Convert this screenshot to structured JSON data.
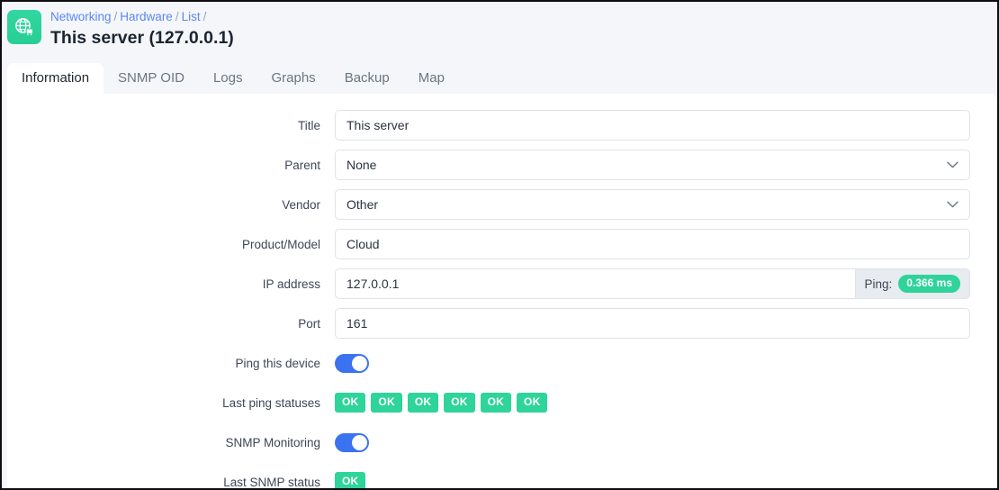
{
  "header": {
    "logo_icon": "globe-network-icon",
    "logo_color": "#2ed49a",
    "breadcrumb": [
      {
        "label": "Networking",
        "sep": "/"
      },
      {
        "label": "Hardware",
        "sep": "/"
      },
      {
        "label": "List",
        "sep": "/"
      }
    ],
    "title": "This server (127.0.0.1)"
  },
  "tabs": [
    {
      "label": "Information",
      "active": true
    },
    {
      "label": "SNMP OID",
      "active": false
    },
    {
      "label": "Logs",
      "active": false
    },
    {
      "label": "Graphs",
      "active": false
    },
    {
      "label": "Backup",
      "active": false
    },
    {
      "label": "Map",
      "active": false
    }
  ],
  "form": {
    "title": {
      "label": "Title",
      "value": "This server",
      "placeholder": ""
    },
    "parent": {
      "label": "Parent",
      "value": "None",
      "chevron": "chevron-down-icon"
    },
    "vendor": {
      "label": "Vendor",
      "value": "Other",
      "chevron": "chevron-down-icon"
    },
    "product_model": {
      "label": "Product/Model",
      "value": "Cloud",
      "placeholder": ""
    },
    "ip_address": {
      "label": "IP address",
      "value": "127.0.0.1",
      "addon_label": "Ping:",
      "ping_value": "0.366 ms",
      "ping_color": "#2ed49a"
    },
    "port": {
      "label": "Port",
      "value": "161",
      "placeholder": ""
    },
    "ping_this_device": {
      "label": "Ping this device",
      "state": "on",
      "on_color": "#3b72f0"
    },
    "last_ping_statuses": {
      "label": "Last ping statuses",
      "values": [
        "OK",
        "OK",
        "OK",
        "OK",
        "OK",
        "OK"
      ],
      "color": "#2ed49a"
    },
    "snmp_monitoring": {
      "label": "SNMP Monitoring",
      "state": "on",
      "on_color": "#3b72f0"
    },
    "last_snmp_status": {
      "label": "Last SNMP status",
      "values": [
        "OK"
      ],
      "color": "#2ed49a"
    }
  }
}
